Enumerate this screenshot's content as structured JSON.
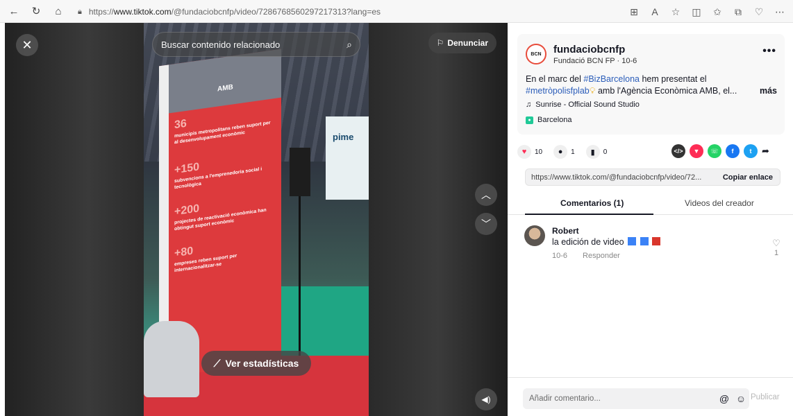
{
  "browser": {
    "url_prefix": "https://",
    "url_host": "www.tiktok.com",
    "url_path": "/@fundaciobcnfp/video/7286768560297217313?lang=es"
  },
  "video": {
    "search_placeholder": "Buscar contenido relacionado",
    "report_label": "Denunciar",
    "stats_label": "Ver estadísticas",
    "booth_sign": "pime",
    "banner_head": "AMB",
    "banner_items": [
      {
        "num": "36",
        "text": "municipis metropolitans reben suport per al desenvolupament econòmic"
      },
      {
        "num": "+150",
        "text": "subvencions a l'emprenedoria social i tecnològica"
      },
      {
        "num": "+200",
        "text": "projectes de reactivació econòmica han obtingut suport econòmic"
      },
      {
        "num": "+80",
        "text": "empreses reben suport per internacionalitzar-se"
      }
    ]
  },
  "post": {
    "username": "fundaciobcnfp",
    "subtitle": "Fundació BCN FP · 10-6",
    "desc_pre": "En el marc del ",
    "tag1": "#BizBarcelona",
    "desc_mid": " hem presentat el ",
    "tag2": "#metròpolisfplab",
    "desc_post": " amb l'Agència Econòmica AMB, el...",
    "more_label": "más",
    "music": "Sunrise - Official Sound Studio",
    "location": "Barcelona",
    "likes": "10",
    "comments": "1",
    "saves": "0",
    "link": "https://www.tiktok.com/@fundaciobcnfp/video/72...",
    "copy_label": "Copiar enlace"
  },
  "tabs": {
    "comments_label": "Comentarios (1)",
    "creator_label": "Videos del creador"
  },
  "comment": {
    "name": "Robert",
    "text": "la edición de video",
    "date": "10-6",
    "reply": "Responder",
    "likes": "1"
  },
  "input": {
    "placeholder": "Añadir comentario...",
    "publish": "Publicar"
  },
  "colors": {
    "accent_red": "#fe2c55",
    "hashtag_blue": "#2b5db9"
  }
}
